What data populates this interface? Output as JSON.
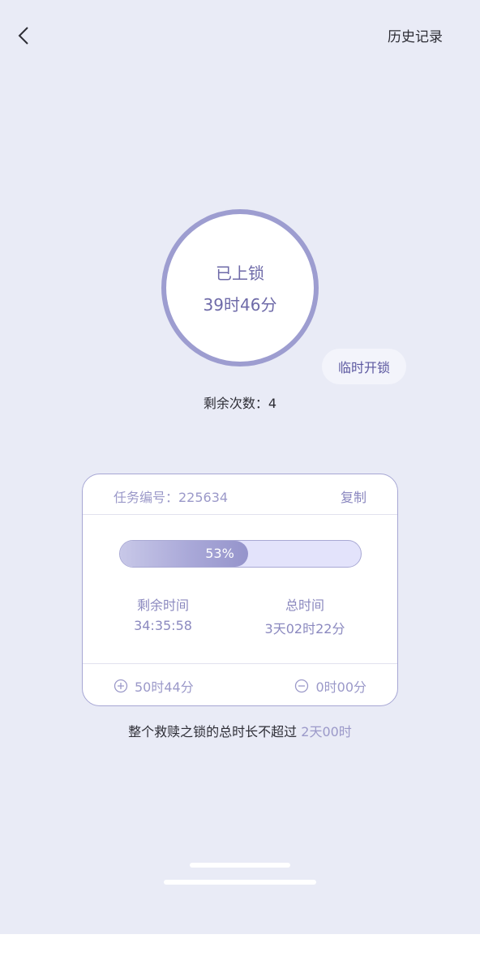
{
  "header": {
    "history_label": "历史记录"
  },
  "lock": {
    "status": "已上锁",
    "time_remaining_display": "39时46分",
    "temp_unlock_label": "临时开锁",
    "remaining_count_text": "剩余次数：4"
  },
  "task": {
    "id_text": "任务编号：225634",
    "copy_label": "复制",
    "progress_percent": 53,
    "progress_label": "53%",
    "remaining_label": "剩余时间",
    "remaining_value": "34:35:58",
    "total_label": "总时间",
    "total_value": "3天02时22分",
    "add_label": "50时44分",
    "subtract_label": "0时00分"
  },
  "limit": {
    "prefix": "整个救赎之锁的总时长不超过 ",
    "value": "2天00时"
  },
  "icons": {
    "back": "chevron-left-icon",
    "add": "plus-circle-icon",
    "subtract": "minus-circle-icon"
  },
  "colors": {
    "background": "#e9ebf6",
    "accent": "#9d9dd0",
    "accent_text": "#9b99c9",
    "text": "#2d2d35"
  }
}
